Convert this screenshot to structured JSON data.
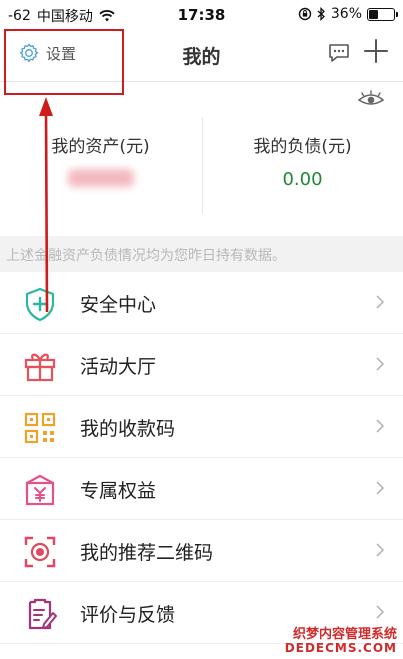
{
  "status_bar": {
    "signal": "-62",
    "carrier": "中国移动",
    "time": "17:38",
    "battery": "36%",
    "battery_level": 0.36
  },
  "nav": {
    "settings_label": "设置",
    "title": "我的"
  },
  "assets": {
    "assets_label": "我的资产(元)",
    "liabilities_label": "我的负债(元)",
    "liabilities_value": "0.00"
  },
  "note": "上述金融资产负债情况均为您昨日持有数据。",
  "menu": {
    "items": [
      {
        "label": "安全中心",
        "icon": "shield-plus-icon"
      },
      {
        "label": "活动大厅",
        "icon": "gift-box-icon"
      },
      {
        "label": "我的收款码",
        "icon": "qr-code-icon"
      },
      {
        "label": "专属权益",
        "icon": "yuan-gift-icon"
      },
      {
        "label": "我的推荐二维码",
        "icon": "scan-frame-icon"
      },
      {
        "label": "评价与反馈",
        "icon": "feedback-edit-icon"
      }
    ]
  },
  "watermark": {
    "line1": "织梦内容管理系统",
    "line2": "DEDECMS.COM"
  },
  "colors": {
    "highlight_red": "#cc1c1c",
    "liabilities_green": "#1f8a34",
    "settings_icon_blue": "#4aa0d8",
    "shield_teal": "#2bb5a3",
    "gift_red": "#e8505b",
    "qr_orange": "#f0a12a",
    "yuan_pink": "#e8508c",
    "scan_red": "#e2485f",
    "feedback_purple": "#a4347a"
  }
}
